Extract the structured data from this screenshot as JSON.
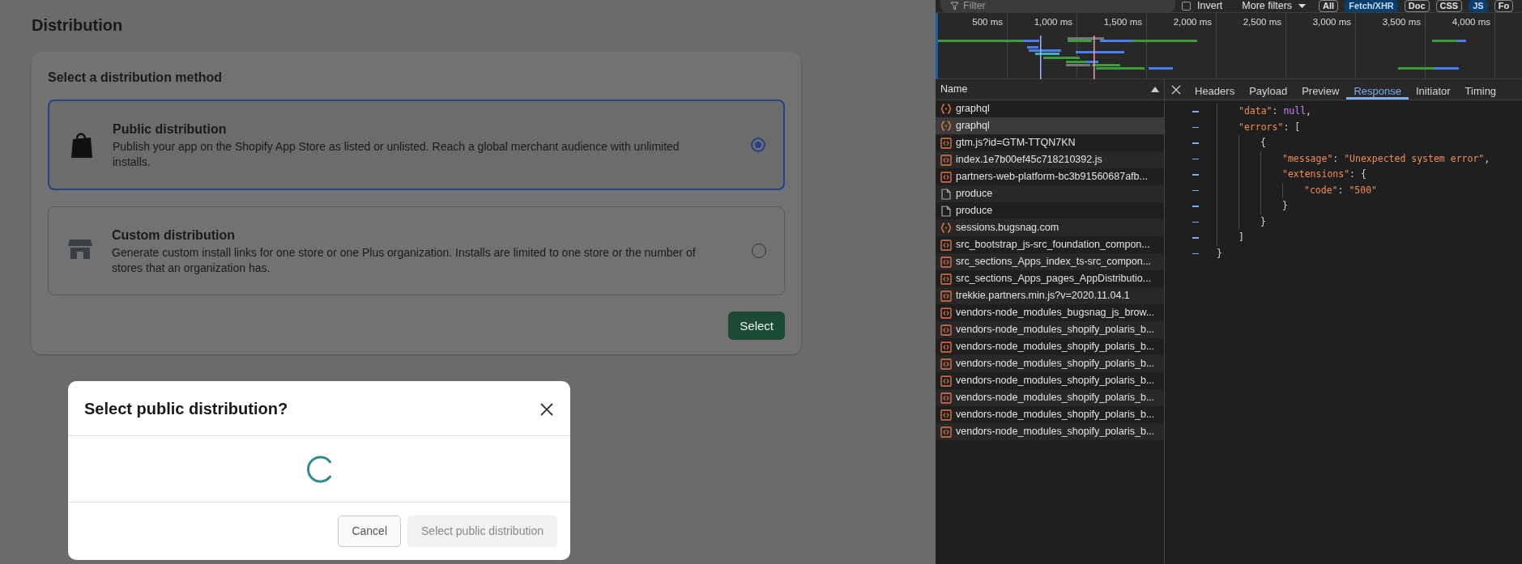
{
  "page": {
    "title": "Distribution",
    "card_title": "Select a distribution method",
    "options": [
      {
        "kind": "bag",
        "name": "Public distribution",
        "description": "Publish your app on the Shopify App Store as listed or unlisted. Reach a global merchant audience with unlimited installs.",
        "selected": true
      },
      {
        "kind": "store",
        "name": "Custom distribution",
        "description": "Generate custom install links for one store or one Plus organization. Installs are limited to one store or the number of stores that an organization has.",
        "selected": false
      }
    ],
    "select_button": "Select"
  },
  "modal": {
    "title": "Select public distribution?",
    "loading": true,
    "buttons": [
      {
        "label": "Cancel",
        "kind": "secondary",
        "disabled": false
      },
      {
        "label": "Select public distribution",
        "kind": "primary",
        "disabled": true
      }
    ]
  },
  "devtools": {
    "filter": {
      "placeholder": "Filter"
    },
    "invert": {
      "label": "Invert",
      "checked": false
    },
    "more_filters": "More filters",
    "type_filters": [
      {
        "label": "All",
        "selected": false
      },
      {
        "label": "Fetch/XHR",
        "selected": true
      },
      {
        "label": "Doc",
        "selected": false
      },
      {
        "label": "CSS",
        "selected": false
      },
      {
        "label": "JS",
        "selected": true
      },
      {
        "label": "Fo",
        "selected": false
      }
    ],
    "timeline_ticks": [
      "500 ms",
      "1,000 ms",
      "1,500 ms",
      "2,000 ms",
      "2,500 ms",
      "3,000 ms",
      "3,500 ms",
      "4,000 ms"
    ],
    "name_column": "Name",
    "requests": [
      {
        "name": "graphql",
        "kind": "fetch",
        "selected": false
      },
      {
        "name": "graphql",
        "kind": "fetch",
        "selected": true
      },
      {
        "name": "gtm.js?id=GTM-TTQN7KN",
        "kind": "script",
        "selected": false
      },
      {
        "name": "index.1e7b00ef45c718210392.js",
        "kind": "script",
        "selected": false
      },
      {
        "name": "partners-web-platform-bc3b91560687afb...",
        "kind": "script",
        "selected": false
      },
      {
        "name": "produce",
        "kind": "document",
        "selected": false
      },
      {
        "name": "produce",
        "kind": "document",
        "selected": false
      },
      {
        "name": "sessions.bugsnag.com",
        "kind": "fetch",
        "selected": false
      },
      {
        "name": "src_bootstrap_js-src_foundation_compon...",
        "kind": "script",
        "selected": false
      },
      {
        "name": "src_sections_Apps_index_ts-src_compon...",
        "kind": "script",
        "selected": false
      },
      {
        "name": "src_sections_Apps_pages_AppDistributio...",
        "kind": "script",
        "selected": false
      },
      {
        "name": "trekkie.partners.min.js?v=2020.11.04.1",
        "kind": "script",
        "selected": false
      },
      {
        "name": "vendors-node_modules_bugsnag_js_brow...",
        "kind": "script",
        "selected": false
      },
      {
        "name": "vendors-node_modules_shopify_polaris_b...",
        "kind": "script",
        "selected": false
      },
      {
        "name": "vendors-node_modules_shopify_polaris_b...",
        "kind": "script",
        "selected": false
      },
      {
        "name": "vendors-node_modules_shopify_polaris_b...",
        "kind": "script",
        "selected": false
      },
      {
        "name": "vendors-node_modules_shopify_polaris_b...",
        "kind": "script",
        "selected": false
      },
      {
        "name": "vendors-node_modules_shopify_polaris_b...",
        "kind": "script",
        "selected": false
      },
      {
        "name": "vendors-node_modules_shopify_polaris_b...",
        "kind": "script",
        "selected": false
      },
      {
        "name": "vendors-node_modules_shopify_polaris_b...",
        "kind": "script",
        "selected": false
      }
    ],
    "detail_tabs": [
      {
        "label": "Headers",
        "selected": false
      },
      {
        "label": "Payload",
        "selected": false
      },
      {
        "label": "Preview",
        "selected": false
      },
      {
        "label": "Response",
        "selected": true
      },
      {
        "label": "Initiator",
        "selected": false
      },
      {
        "label": "Timing",
        "selected": false
      }
    ],
    "response": {
      "lines": [
        {
          "tokens": [
            {
              "text": "\"data\"",
              "kind": "key"
            },
            {
              "text": ": ",
              "kind": "punct"
            },
            {
              "text": "null",
              "kind": "null"
            },
            {
              "text": ",",
              "kind": "punct"
            }
          ]
        },
        {
          "tokens": [
            {
              "text": "\"errors\"",
              "kind": "key"
            },
            {
              "text": ": [",
              "kind": "punct"
            }
          ],
          "children": [
            {
              "tokens": [
                {
                  "text": "{",
                  "kind": "punct"
                }
              ],
              "children": [
                {
                  "tokens": [
                    {
                      "text": "\"message\"",
                      "kind": "key"
                    },
                    {
                      "text": ": ",
                      "kind": "punct"
                    },
                    {
                      "text": "\"Unexpected system error\"",
                      "kind": "string"
                    },
                    {
                      "text": ",",
                      "kind": "punct"
                    }
                  ]
                },
                {
                  "tokens": [
                    {
                      "text": "\"extensions\"",
                      "kind": "key"
                    },
                    {
                      "text": ": {",
                      "kind": "punct"
                    }
                  ],
                  "children": [
                    {
                      "tokens": [
                        {
                          "text": "\"code\"",
                          "kind": "key"
                        },
                        {
                          "text": ": ",
                          "kind": "punct"
                        },
                        {
                          "text": "\"500\"",
                          "kind": "string"
                        }
                      ]
                    }
                  ]
                },
                {
                  "tokens": [
                    {
                      "text": "}",
                      "kind": "punct"
                    }
                  ]
                }
              ]
            },
            {
              "tokens": [
                {
                  "text": "}",
                  "kind": "punct"
                }
              ]
            }
          ]
        },
        {
          "tokens": [
            {
              "text": "]",
              "kind": "punct"
            }
          ]
        }
      ],
      "closing": "}"
    }
  }
}
